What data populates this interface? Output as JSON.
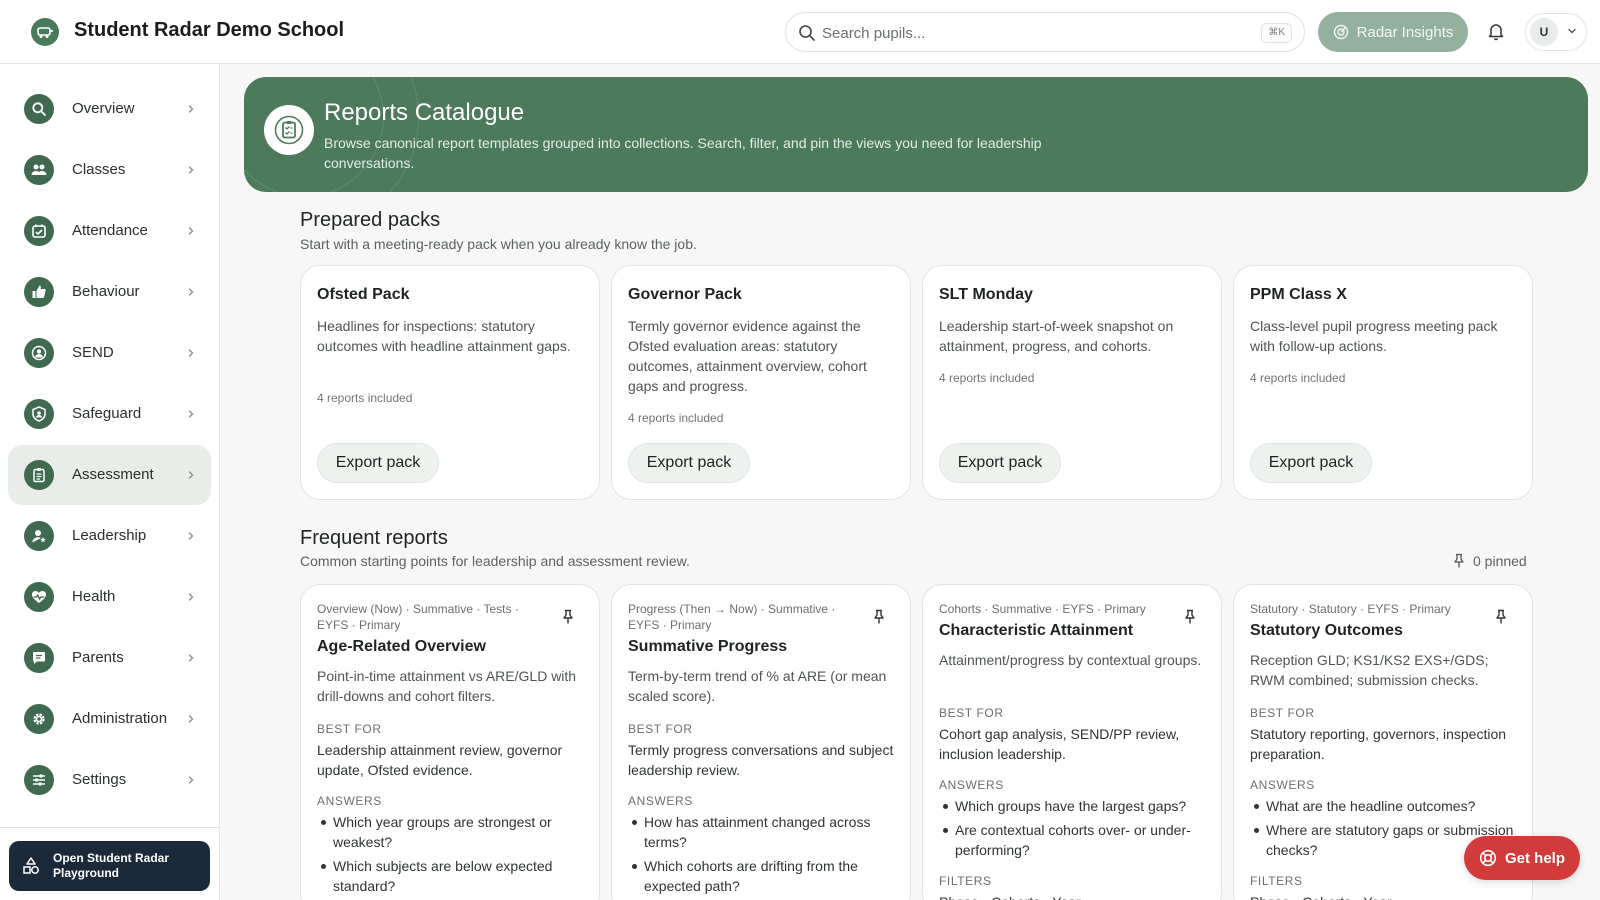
{
  "header": {
    "school_name": "Student Radar Demo School",
    "search_placeholder": "Search pupils...",
    "search_shortcut": "⌘K",
    "insights_label": "Radar Insights",
    "avatar_initial": "U"
  },
  "sidebar": {
    "items": [
      {
        "label": "Overview",
        "icon": "search-icon"
      },
      {
        "label": "Classes",
        "icon": "people-icon"
      },
      {
        "label": "Attendance",
        "icon": "calendar-check-icon"
      },
      {
        "label": "Behaviour",
        "icon": "thumbs-up-icon"
      },
      {
        "label": "SEND",
        "icon": "person-circle-icon"
      },
      {
        "label": "Safeguard",
        "icon": "shield-icon"
      },
      {
        "label": "Assessment",
        "icon": "clipboard-icon",
        "active": true
      },
      {
        "label": "Leadership",
        "icon": "person-star-icon"
      },
      {
        "label": "Health",
        "icon": "heart-pulse-icon"
      },
      {
        "label": "Parents",
        "icon": "chat-icon"
      },
      {
        "label": "Administration",
        "icon": "gear-icon"
      },
      {
        "label": "Settings",
        "icon": "sliders-icon"
      }
    ],
    "playground_label": "Open Student Radar Playground"
  },
  "banner": {
    "title": "Reports Catalogue",
    "description": "Browse canonical report templates grouped into collections. Search, filter, and pin the views you need for leadership conversations."
  },
  "packs": {
    "title": "Prepared packs",
    "subtitle": "Start with a meeting-ready pack when you already know the job.",
    "items": [
      {
        "title": "Ofsted Pack",
        "description": "Headlines for inspections: statutory outcomes with headline attainment gaps.",
        "count": "4 reports included",
        "button": "Export pack"
      },
      {
        "title": "Governor Pack",
        "description": "Termly governor evidence against the Ofsted evaluation areas: statutory outcomes, attainment overview, cohort gaps and progress.",
        "count": "4 reports included",
        "button": "Export pack"
      },
      {
        "title": "SLT Monday",
        "description": "Leadership start-of-week snapshot on attainment, progress, and cohorts.",
        "count": "4 reports included",
        "button": "Export pack"
      },
      {
        "title": "PPM Class X",
        "description": "Class-level pupil progress meeting pack with follow-up actions.",
        "count": "4 reports included",
        "button": "Export pack"
      }
    ]
  },
  "frequent": {
    "title": "Frequent reports",
    "subtitle": "Common starting points for leadership and assessment review.",
    "pinned_label": "0 pinned",
    "best_for_label": "BEST FOR",
    "answers_label": "ANSWERS",
    "filters_label": "FILTERS",
    "items": [
      {
        "meta": "Overview (Now) · Summative · Tests · EYFS · Primary",
        "title": "Age-Related Overview",
        "description": "Point-in-time attainment vs ARE/GLD with drill-downs and cohort filters.",
        "best_for": "Leadership attainment review, governor update, Ofsted evidence.",
        "answers": [
          "Which year groups are strongest or weakest?",
          "Which subjects are below expected standard?"
        ]
      },
      {
        "meta": "Progress (Then → Now) · Summative · EYFS · Primary",
        "title": "Summative Progress",
        "description": "Term-by-term trend of % at ARE (or mean scaled score).",
        "best_for": "Termly progress conversations and subject leadership review.",
        "answers": [
          "How has attainment changed across terms?",
          "Which cohorts are drifting from the expected path?"
        ]
      },
      {
        "meta": "Cohorts · Summative · EYFS · Primary",
        "title": "Characteristic Attainment",
        "description": "Attainment/progress by contextual groups.",
        "best_for": "Cohort gap analysis, SEND/PP review, inclusion leadership.",
        "answers": [
          "Which groups have the largest gaps?",
          "Are contextual cohorts over- or under-performing?"
        ],
        "filters": "Phase · Cohorts · Year"
      },
      {
        "meta": "Statutory · Statutory · EYFS · Primary",
        "title": "Statutory Outcomes",
        "description": "Reception GLD; KS1/KS2 EXS+/GDS; RWM combined; submission checks.",
        "best_for": "Statutory reporting, governors, inspection preparation.",
        "answers": [
          "What are the headline outcomes?",
          "Where are statutory gaps or submission checks?"
        ],
        "filters": "Phase · Cohorts · Year"
      }
    ]
  },
  "help_label": "Get help",
  "colors": {
    "brand_green": "#4c7a5b",
    "nav_icon_green": "#3f6a50",
    "insights_green": "#94b19f",
    "help_red": "#d23b3b",
    "playground_navy": "#1b2a3a"
  }
}
